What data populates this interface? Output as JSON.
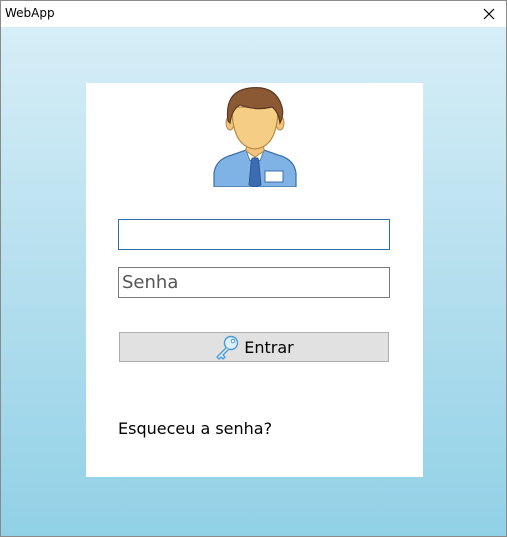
{
  "window": {
    "title": "WebApp",
    "close_icon": "close-icon"
  },
  "login": {
    "avatar_icon": "user-avatar-icon",
    "username": {
      "value": "",
      "placeholder": ""
    },
    "password": {
      "value": "",
      "placeholder": "Senha"
    },
    "submit_label": "Entrar",
    "submit_icon": "key-icon",
    "forgot_label": "Esqueceu a senha?"
  },
  "colors": {
    "gradient_top": "#d6eef7",
    "gradient_bottom": "#91d1e6",
    "focus_border": "#2f6fa8",
    "button_bg": "#e1e1e1"
  }
}
